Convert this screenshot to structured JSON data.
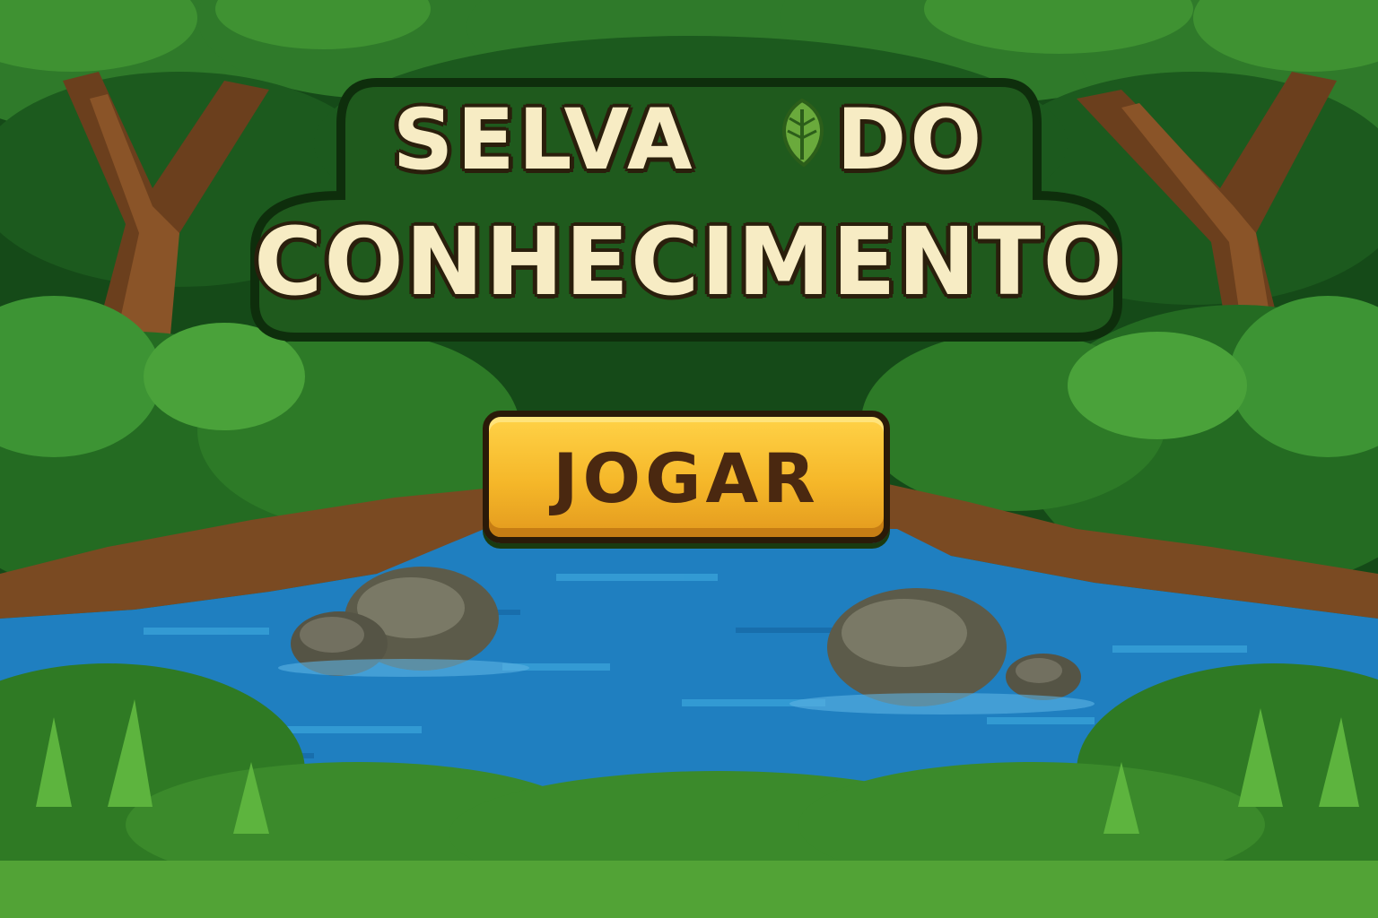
{
  "game": {
    "title_line_1": "SELVA DO",
    "title_line_2": "CONHECIMENTO",
    "play_button_label": "JOGAR"
  },
  "icons": {
    "title_ornament": "leaf-icon"
  },
  "colors": {
    "title_text": "#f7ecc4",
    "title_plate": "#1f5a1d",
    "button_fill": "#f5b729",
    "button_text": "#4a2810",
    "river": "#1f7fc0",
    "jungle_dark": "#12441a"
  }
}
